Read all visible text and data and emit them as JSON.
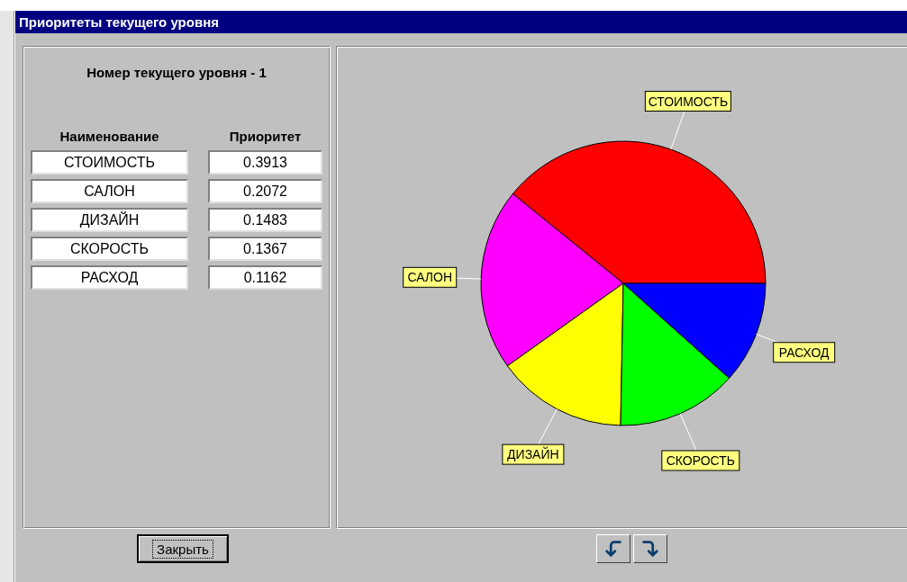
{
  "window": {
    "title": "Приоритеты текущего уровня"
  },
  "level_label": "Номер текущего уровня - 1",
  "table": {
    "columns": [
      "Наименование",
      "Приоритет"
    ],
    "rows": [
      {
        "name": "СТОИМОСТЬ",
        "priority": "0.3913"
      },
      {
        "name": "САЛОН",
        "priority": "0.2072"
      },
      {
        "name": "ДИЗАЙН",
        "priority": "0.1483"
      },
      {
        "name": "СКОРОСТЬ",
        "priority": "0.1367"
      },
      {
        "name": "РАСХОД",
        "priority": "0.1162"
      }
    ]
  },
  "chart": {
    "chart_data": {
      "type": "pie",
      "categories": [
        "СТОИМОСТЬ",
        "САЛОН",
        "ДИЗАЙН",
        "СКОРОСТЬ",
        "РАСХОД"
      ],
      "values": [
        0.3913,
        0.2072,
        0.1483,
        0.1367,
        0.1162
      ],
      "colors": [
        "#ff0000",
        "#ff00ff",
        "#ffff00",
        "#00ff00",
        "#0000ff"
      ]
    }
  },
  "buttons": {
    "close": "Закрыть"
  }
}
